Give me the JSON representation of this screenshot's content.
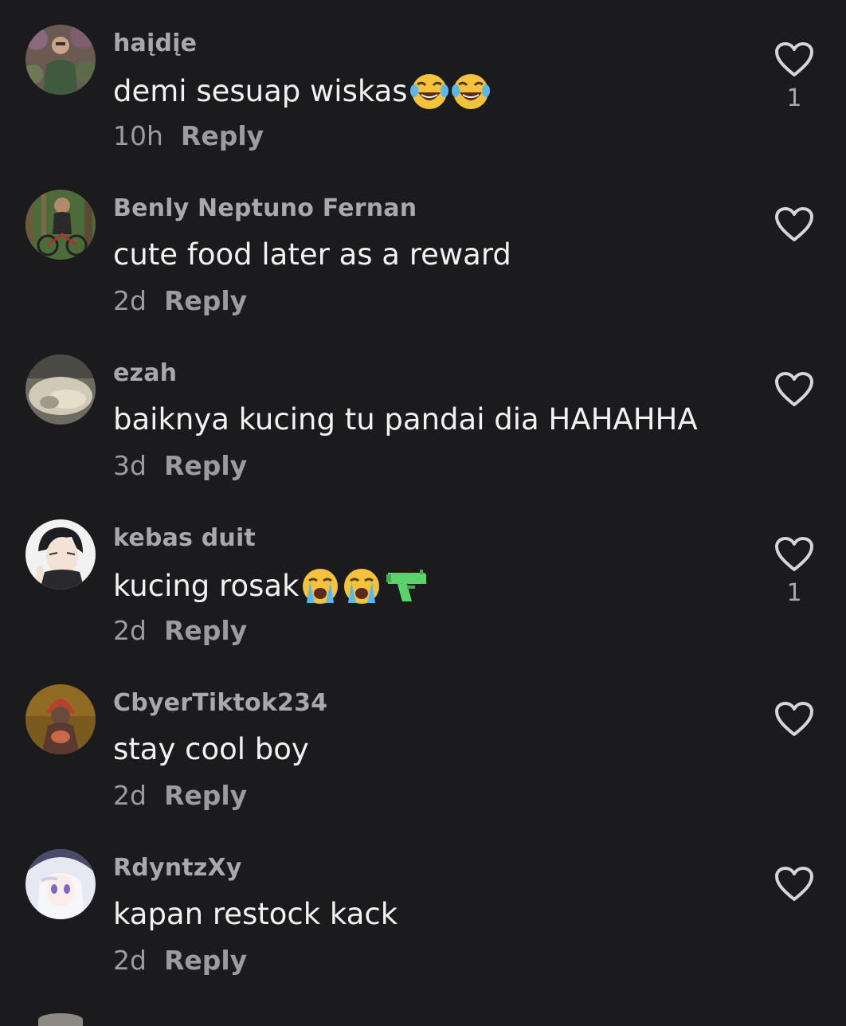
{
  "comments": [
    {
      "username": "haįdįe",
      "text": "demi sesuap wiskas",
      "emoji": [
        "laughing-tears-emoji",
        "laughing-tears-emoji"
      ],
      "time": "10h",
      "reply": "Reply",
      "likes": "1",
      "avatar": "avatar-person-green-shirt"
    },
    {
      "username": "Benly Neptuno Fernan",
      "text": "cute food later as a reward",
      "emoji": [],
      "time": "2d",
      "reply": "Reply",
      "likes": "",
      "avatar": "avatar-cyclist-forest"
    },
    {
      "username": "ezah",
      "text": "baiknya kucing tu pandai dia HAHAHHA",
      "emoji": [],
      "time": "3d",
      "reply": "Reply",
      "likes": "",
      "avatar": "avatar-blurry-photo"
    },
    {
      "username": "kebas duit",
      "text": "kucing rosak",
      "emoji": [
        "loudly-crying-emoji",
        "loudly-crying-emoji",
        "water-pistol-emoji"
      ],
      "time": "2d",
      "reply": "Reply",
      "likes": "1",
      "avatar": "avatar-anime-boy"
    },
    {
      "username": "CbyerTiktok234",
      "text": "stay cool boy",
      "emoji": [],
      "time": "2d",
      "reply": "Reply",
      "likes": "",
      "avatar": "avatar-red-hood"
    },
    {
      "username": "RdyntzXy",
      "text": "kapan restock kack",
      "emoji": [],
      "time": "2d",
      "reply": "Reply",
      "likes": "",
      "avatar": "avatar-anime-girl"
    }
  ],
  "colors": {
    "background": "#1b1b1d",
    "username": "#a9a9ab",
    "comment_text": "#f2f2f2",
    "meta": "#9c9c9e",
    "heart_outline": "#d6d6d8"
  }
}
